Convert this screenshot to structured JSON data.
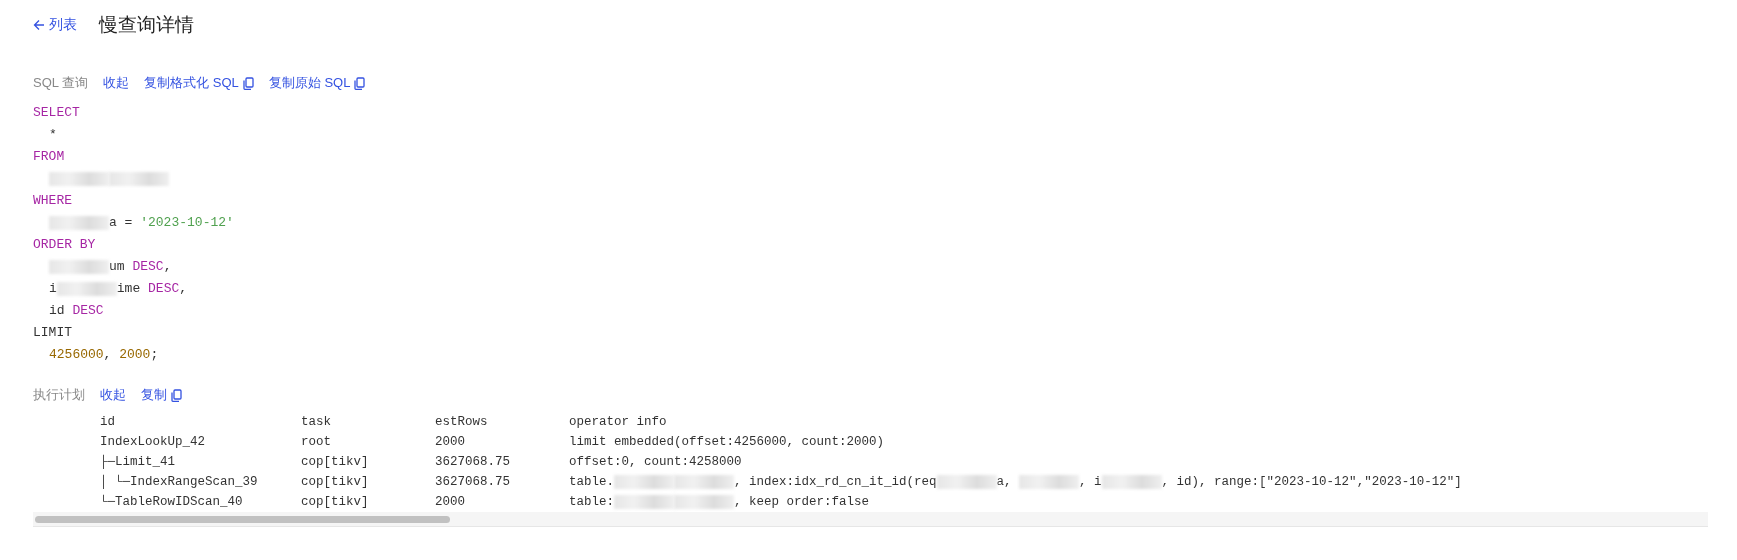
{
  "header": {
    "back_link": "列表",
    "title": "慢查询详情"
  },
  "sql_section": {
    "label": "SQL 查询",
    "actions": [
      {
        "label": "收起",
        "kind": "link"
      },
      {
        "label": "复制格式化 SQL",
        "kind": "copy"
      },
      {
        "label": "复制原始 SQL",
        "kind": "copy"
      }
    ],
    "lines": [
      [
        {
          "kind": "keyword",
          "text": "SELECT"
        }
      ],
      [
        {
          "kind": "indent"
        },
        {
          "kind": "plain",
          "text": "*"
        }
      ],
      [
        {
          "kind": "keyword",
          "text": "FROM"
        }
      ],
      [
        {
          "kind": "indent"
        },
        {
          "kind": "redacted"
        },
        {
          "kind": "redacted"
        }
      ],
      [
        {
          "kind": "keyword",
          "text": "WHERE"
        }
      ],
      [
        {
          "kind": "indent"
        },
        {
          "kind": "redacted"
        },
        {
          "kind": "plain",
          "text": "a = "
        },
        {
          "kind": "string",
          "text": "'2023-10-12'"
        }
      ],
      [
        {
          "kind": "keyword",
          "text": "ORDER BY"
        }
      ],
      [
        {
          "kind": "indent"
        },
        {
          "kind": "redacted"
        },
        {
          "kind": "plain",
          "text": "um "
        },
        {
          "kind": "keyword",
          "text": "DESC"
        },
        {
          "kind": "plain",
          "text": ","
        }
      ],
      [
        {
          "kind": "indent"
        },
        {
          "kind": "plain",
          "text": "i"
        },
        {
          "kind": "redacted"
        },
        {
          "kind": "plain",
          "text": "ime "
        },
        {
          "kind": "keyword",
          "text": "DESC"
        },
        {
          "kind": "plain",
          "text": ","
        }
      ],
      [
        {
          "kind": "indent"
        },
        {
          "kind": "plain",
          "text": "id "
        },
        {
          "kind": "keyword",
          "text": "DESC"
        }
      ],
      [
        {
          "kind": "plain",
          "text": "LIMIT"
        }
      ],
      [
        {
          "kind": "indent"
        },
        {
          "kind": "number",
          "text": "4256000"
        },
        {
          "kind": "plain",
          "text": ", "
        },
        {
          "kind": "number",
          "text": "2000"
        },
        {
          "kind": "plain",
          "text": ";"
        }
      ]
    ]
  },
  "plan_section": {
    "label": "执行计划",
    "actions": [
      {
        "label": "收起",
        "kind": "link"
      },
      {
        "label": "复制",
        "kind": "copy"
      }
    ],
    "table": {
      "columns": [
        "id",
        "task",
        "estRows",
        "operator info"
      ],
      "rows": [
        [
          [
            {
              "kind": "plain",
              "text": "IndexLookUp_42"
            }
          ],
          [
            {
              "kind": "plain",
              "text": "root"
            }
          ],
          [
            {
              "kind": "plain",
              "text": "2000"
            }
          ],
          [
            {
              "kind": "plain",
              "text": "limit embedded(offset:4256000, count:2000)"
            }
          ]
        ],
        [
          [
            {
              "kind": "plain",
              "text": "├─Limit_41"
            }
          ],
          [
            {
              "kind": "plain",
              "text": "cop[tikv]"
            }
          ],
          [
            {
              "kind": "plain",
              "text": "3627068.75"
            }
          ],
          [
            {
              "kind": "plain",
              "text": "offset:0, count:4258000"
            }
          ]
        ],
        [
          [
            {
              "kind": "plain",
              "text": "│ └─IndexRangeScan_39"
            }
          ],
          [
            {
              "kind": "plain",
              "text": "cop[tikv]"
            }
          ],
          [
            {
              "kind": "plain",
              "text": "3627068.75"
            }
          ],
          [
            {
              "kind": "plain",
              "text": "table."
            },
            {
              "kind": "redacted"
            },
            {
              "kind": "redacted"
            },
            {
              "kind": "plain",
              "text": ", index:idx_rd_cn_it_id(req"
            },
            {
              "kind": "redacted"
            },
            {
              "kind": "plain",
              "text": "a, "
            },
            {
              "kind": "redacted"
            },
            {
              "kind": "plain",
              "text": ", i"
            },
            {
              "kind": "redacted"
            },
            {
              "kind": "plain",
              "text": ", id), range:[\"2023-10-12\",\"2023-10-12\"]"
            }
          ]
        ],
        [
          [
            {
              "kind": "plain",
              "text": "└─TableRowIDScan_40"
            }
          ],
          [
            {
              "kind": "plain",
              "text": "cop[tikv]"
            }
          ],
          [
            {
              "kind": "plain",
              "text": "2000"
            }
          ],
          [
            {
              "kind": "plain",
              "text": "table:"
            },
            {
              "kind": "redacted"
            },
            {
              "kind": "redacted"
            },
            {
              "kind": "plain",
              "text": ", keep order:false"
            }
          ]
        ]
      ]
    }
  }
}
